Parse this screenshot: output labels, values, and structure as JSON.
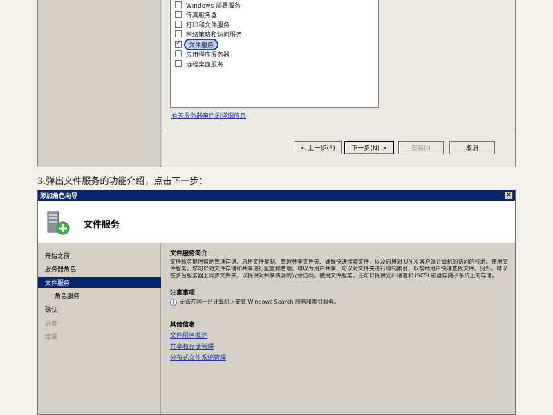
{
  "top_wizard": {
    "roles": [
      {
        "label": "Windows 部署服务",
        "checked": false
      },
      {
        "label": "传真服务器",
        "checked": false
      },
      {
        "label": "打印和文件服务",
        "checked": false
      },
      {
        "label": "网络策略和访问服务",
        "checked": false
      },
      {
        "label": "文件服务",
        "checked": true,
        "highlighted": true
      },
      {
        "label": "应用程序服务器",
        "checked": false
      },
      {
        "label": "远程桌面服务",
        "checked": false
      }
    ],
    "more_info_link": "有关服务器角色的详细信息",
    "buttons": {
      "prev": "< 上一步(P)",
      "next": "下一步(N) >",
      "install": "安装(I)",
      "cancel": "取消"
    }
  },
  "caption": "3.弹出文件服务的功能介绍，点击下一步：",
  "wizard": {
    "title": "添加角色向导",
    "close": "×",
    "header_title": "文件服务",
    "nav": [
      {
        "label": "开始之前",
        "state": "normal"
      },
      {
        "label": "服务器角色",
        "state": "normal"
      },
      {
        "label": "文件服务",
        "state": "selected"
      },
      {
        "label": "角色服务",
        "state": "sub"
      },
      {
        "label": "确认",
        "state": "normal"
      },
      {
        "label": "进度",
        "state": "disabled"
      },
      {
        "label": "结果",
        "state": "disabled"
      }
    ],
    "intro_heading": "文件服务简介",
    "intro_text": "文件服务提供帮助管理存储、启用文件复制、管理共享文件夹、确保快速搜索文件，以及启用对 UNIX 客户端计算机的访问的技术。使用文件服务，您可以对文件存储和共享进行配置和管理。可以为用户共享、可以对文件夹进行编制索引，以帮助用户快速查找文件。另外，可以在多台服务器上同步文件夹，以提供对共享资源的冗余访问。使用文件服务，还可以提供光纤通道和 iSCSI 磁盘存储子系统上的存储。",
    "note_heading": "注意事项",
    "note_text": "无法在同一台计算机上安装 Windows Search 服务和索引服务。",
    "more_heading": "其他信息",
    "links": [
      "文件服务概述",
      "共享和存储管理",
      "分布式文件系统管理"
    ]
  },
  "colors": {
    "title_bar": "#0a246a",
    "selection": "#0a246a",
    "link": "#1a3d9e",
    "annotation_circle": "#1c3fbf"
  }
}
